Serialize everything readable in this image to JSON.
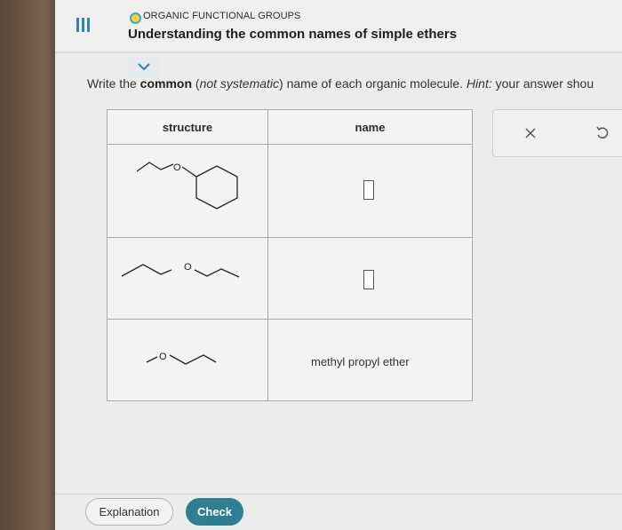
{
  "header": {
    "section": "ORGANIC FUNCTIONAL GROUPS",
    "title": "Understanding the common names of simple ethers"
  },
  "prompt": {
    "p1": "Write the ",
    "p2": "common",
    "p3": " (",
    "p4": "not systematic",
    "p5": ") name of each organic molecule. ",
    "p6": "Hint:",
    "p7": " your answer shou"
  },
  "table": {
    "headers": [
      "structure",
      "name"
    ],
    "rows": [
      {
        "oxygen_label": "O",
        "answer": ""
      },
      {
        "oxygen_label": "O",
        "answer": ""
      },
      {
        "oxygen_label": "O",
        "answer": "methyl propyl ether"
      }
    ]
  },
  "footer": {
    "explanation_label": "Explanation",
    "check_label": "Check"
  },
  "colors": {
    "accent": "#2f7f93",
    "menu": "#2e86a8",
    "section_dot": "#ffd23a"
  },
  "icons": {
    "menu": "hamburger-icon",
    "collapse": "chevron-down-icon",
    "clear": "close-icon",
    "undo": "undo-icon"
  }
}
